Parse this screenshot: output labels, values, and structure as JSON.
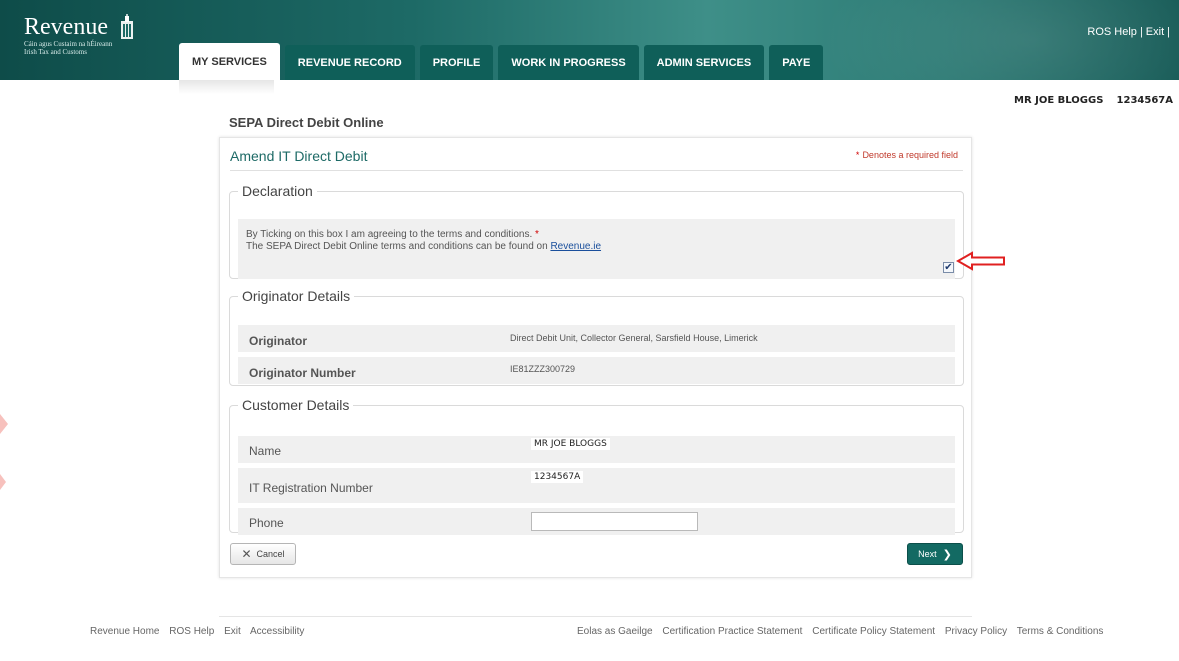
{
  "header": {
    "logo": {
      "word": "Revenue",
      "sub_line1": "Cáin agus Custaim na hÉireann",
      "sub_line2": "Irish Tax and Customs"
    },
    "links": [
      {
        "label": "ROS Help"
      },
      {
        "label": "Exit"
      }
    ],
    "tabs": [
      {
        "label": "MY SERVICES",
        "active": true
      },
      {
        "label": "REVENUE RECORD"
      },
      {
        "label": "PROFILE"
      },
      {
        "label": "WORK IN PROGRESS"
      },
      {
        "label": "ADMIN SERVICES"
      },
      {
        "label": "PAYE"
      }
    ]
  },
  "user": {
    "name": "MR JOE BLOGGS",
    "reference": "1234567A"
  },
  "page": {
    "title": "SEPA Direct Debit Online",
    "card_title": "Amend IT Direct Debit",
    "required_note": "Denotes a required field",
    "required_star": "*"
  },
  "declaration": {
    "legend": "Declaration",
    "line1": "By Ticking on this box I am agreeing to the terms and conditions.",
    "line2_prefix": "The SEPA Direct Debit Online terms and conditions can be found on",
    "link": "Revenue.ie",
    "checked": true,
    "check_mark": "✔"
  },
  "originator": {
    "legend": "Originator Details",
    "rows": [
      {
        "label": "Originator",
        "value": "Direct Debit Unit, Collector General, Sarsfield House, Limerick"
      },
      {
        "label": "Originator Number",
        "value": "IE81ZZZ300729"
      }
    ]
  },
  "customer": {
    "legend": "Customer Details",
    "rows": [
      {
        "label": "Name",
        "value": "MR JOE BLOGGS"
      },
      {
        "label": "IT Registration Number",
        "value": "1234567A"
      },
      {
        "label": "Phone",
        "value": ""
      }
    ]
  },
  "buttons": {
    "cancel": "Cancel",
    "next": "Next"
  },
  "footer": {
    "left": [
      "Revenue Home",
      "ROS Help",
      "Exit",
      "Accessibility"
    ],
    "right": [
      "Eolas as Gaeilge",
      "Certification Practice Statement",
      "Certificate Policy Statement",
      "Privacy Policy",
      "Terms & Conditions"
    ]
  },
  "colors": {
    "brand": "#136a63",
    "header_dark": "#0e4c49",
    "required": "#d00000",
    "arrow": "#e02020"
  }
}
